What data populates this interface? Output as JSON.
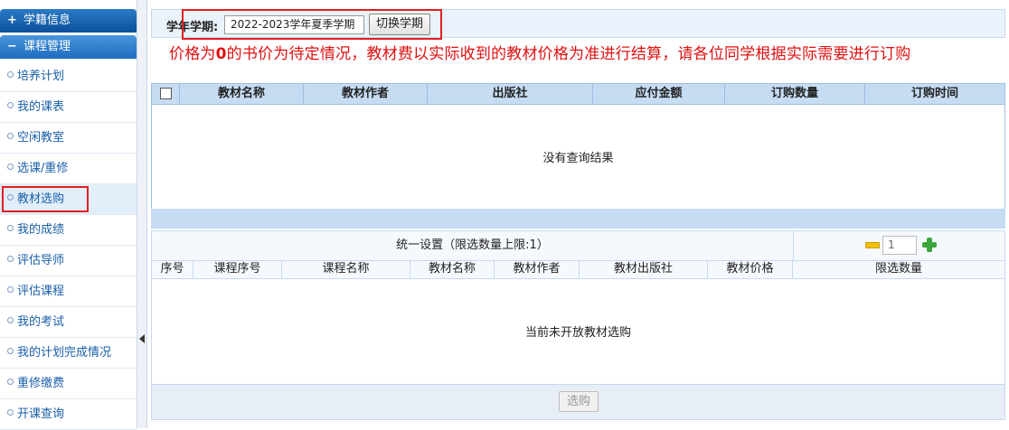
{
  "sidebar": {
    "sections": [
      {
        "label": "学籍信息",
        "symbol": "+"
      },
      {
        "label": "课程管理",
        "symbol": "−"
      }
    ],
    "items": [
      {
        "label": "培养计划"
      },
      {
        "label": "我的课表"
      },
      {
        "label": "空闲教室"
      },
      {
        "label": "选课/重修"
      },
      {
        "label": "教材选购"
      },
      {
        "label": "我的成绩"
      },
      {
        "label": "评估导师"
      },
      {
        "label": "评估课程"
      },
      {
        "label": "我的考试"
      },
      {
        "label": "我的计划完成情况"
      },
      {
        "label": "重修缴费"
      },
      {
        "label": "开课查询"
      }
    ],
    "selected_index": 4
  },
  "term": {
    "label": "学年学期:",
    "value": "2022-2023学年夏季学期",
    "switch_label": "切换学期"
  },
  "notice": {
    "prefix": "价格为",
    "bold": "0",
    "rest": "的书价为待定情况，教材费以实际收到的教材价格为准进行结算，请各位同学根据实际需要进行订购"
  },
  "order_table": {
    "columns": [
      "教材名称",
      "教材作者",
      "出版社",
      "应付金额",
      "订购数量",
      "订购时间"
    ],
    "empty_text": "没有查询结果"
  },
  "setting": {
    "label": "统一设置（限选数量上限:1）",
    "qty_value": "1"
  },
  "course_table": {
    "columns": [
      "序号",
      "课程序号",
      "课程名称",
      "教材名称",
      "教材作者",
      "教材出版社",
      "教材价格",
      "限选数量"
    ],
    "empty_text": "当前未开放教材选购"
  },
  "buy_button": "选购",
  "colors": {
    "notice": "#e01010",
    "highlight_box": "#e02020",
    "header_blue": "#c6dcf3"
  }
}
